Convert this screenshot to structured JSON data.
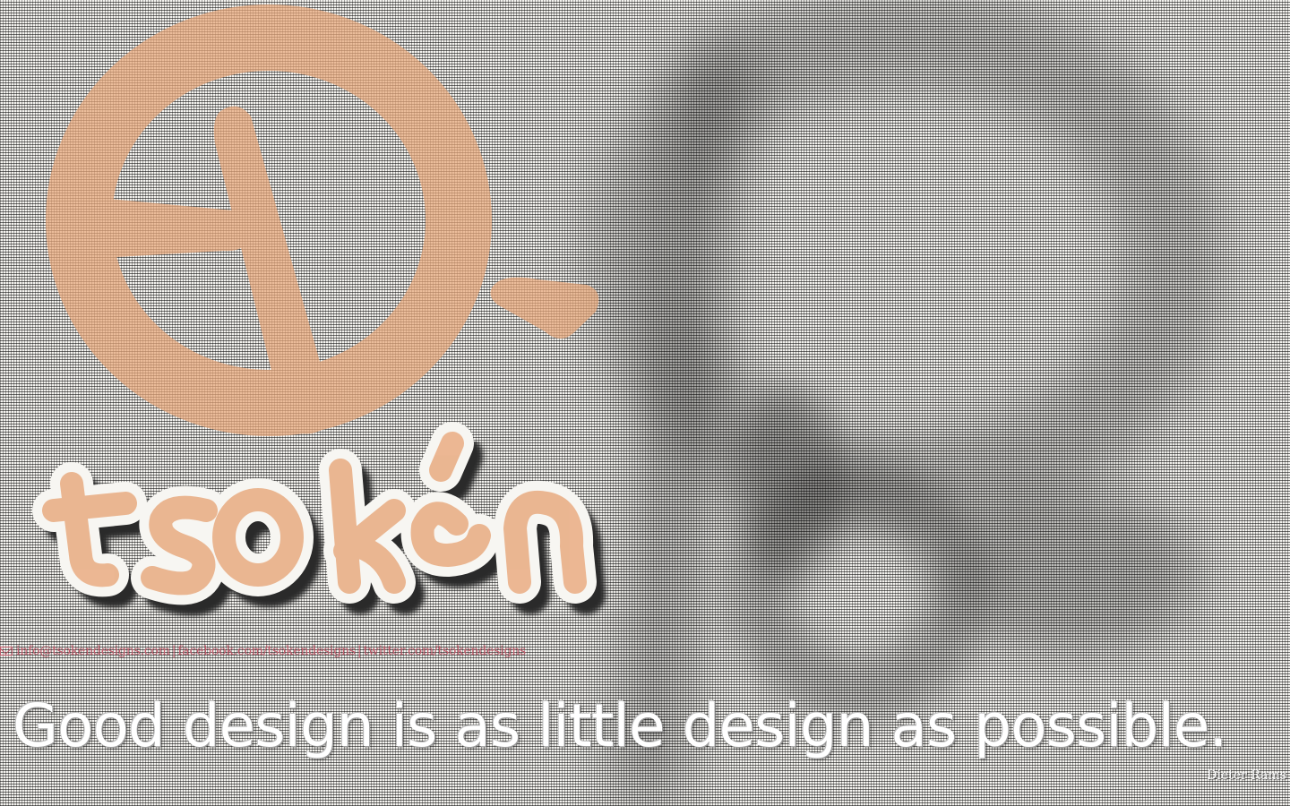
{
  "brand": {
    "wordmark": "tsoken",
    "accent_color": "#e8a77a",
    "shadow_color": "#2a2a2a"
  },
  "contact": {
    "mail_icon": "mail-icon",
    "email": "info@tsokendesigns.com",
    "separator": "|",
    "facebook": "facebook.com/tsokendesigns",
    "twitter": "twitter.com/tsokendesigns",
    "link_color": "#c05a6a"
  },
  "quote": {
    "text": "Good design is as little design as possible.",
    "author": "Dieter Rams"
  }
}
